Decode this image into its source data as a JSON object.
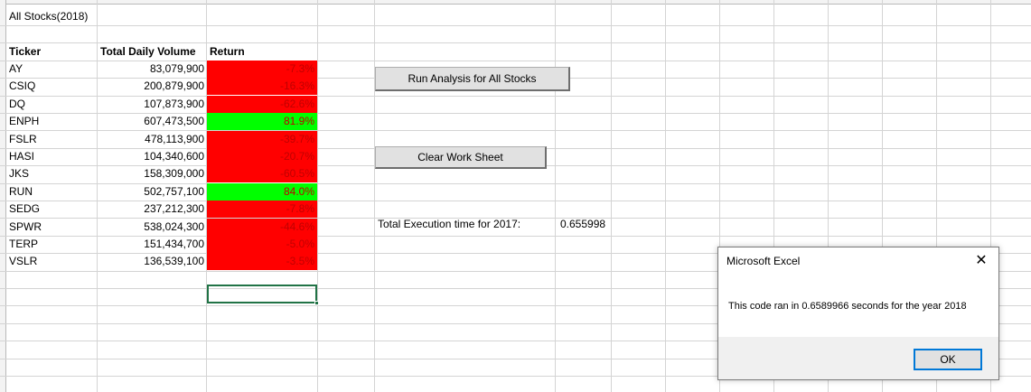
{
  "sheet": {
    "a1": "All Stocks(2018)",
    "headers": {
      "ticker": "Ticker",
      "volume": "Total Daily Volume",
      "return": "Return"
    },
    "rows": [
      {
        "ticker": "AY",
        "volume": "83,079,900",
        "return": "-7.3%",
        "positive": false
      },
      {
        "ticker": "CSIQ",
        "volume": "200,879,900",
        "return": "-16.3%",
        "positive": false
      },
      {
        "ticker": "DQ",
        "volume": "107,873,900",
        "return": "-62.6%",
        "positive": false
      },
      {
        "ticker": "ENPH",
        "volume": "607,473,500",
        "return": "81.9%",
        "positive": true
      },
      {
        "ticker": "FSLR",
        "volume": "478,113,900",
        "return": "-39.7%",
        "positive": false
      },
      {
        "ticker": "HASI",
        "volume": "104,340,600",
        "return": "-20.7%",
        "positive": false
      },
      {
        "ticker": "JKS",
        "volume": "158,309,000",
        "return": "-60.5%",
        "positive": false
      },
      {
        "ticker": "RUN",
        "volume": "502,757,100",
        "return": "84.0%",
        "positive": true
      },
      {
        "ticker": "SEDG",
        "volume": "237,212,300",
        "return": "-7.8%",
        "positive": false
      },
      {
        "ticker": "SPWR",
        "volume": "538,024,300",
        "return": "-44.6%",
        "positive": false
      },
      {
        "ticker": "TERP",
        "volume": "151,434,700",
        "return": "-5.0%",
        "positive": false
      },
      {
        "ticker": "VSLR",
        "volume": "136,539,100",
        "return": "-3.5%",
        "positive": false
      }
    ],
    "exec_label": "Total Execution time for 2017:",
    "exec_value": "0.655998"
  },
  "buttons": {
    "run_label": "Run Analysis for All Stocks",
    "clear_label": "Clear Work Sheet"
  },
  "dialog": {
    "title": "Microsoft Excel",
    "message": "This code ran in 0.6589966 seconds for the year 2018",
    "ok_label": "OK",
    "close_glyph": "✕"
  },
  "colors": {
    "positive_fill": "#00ff00",
    "negative_fill": "#ff0000",
    "selection": "#217346"
  }
}
